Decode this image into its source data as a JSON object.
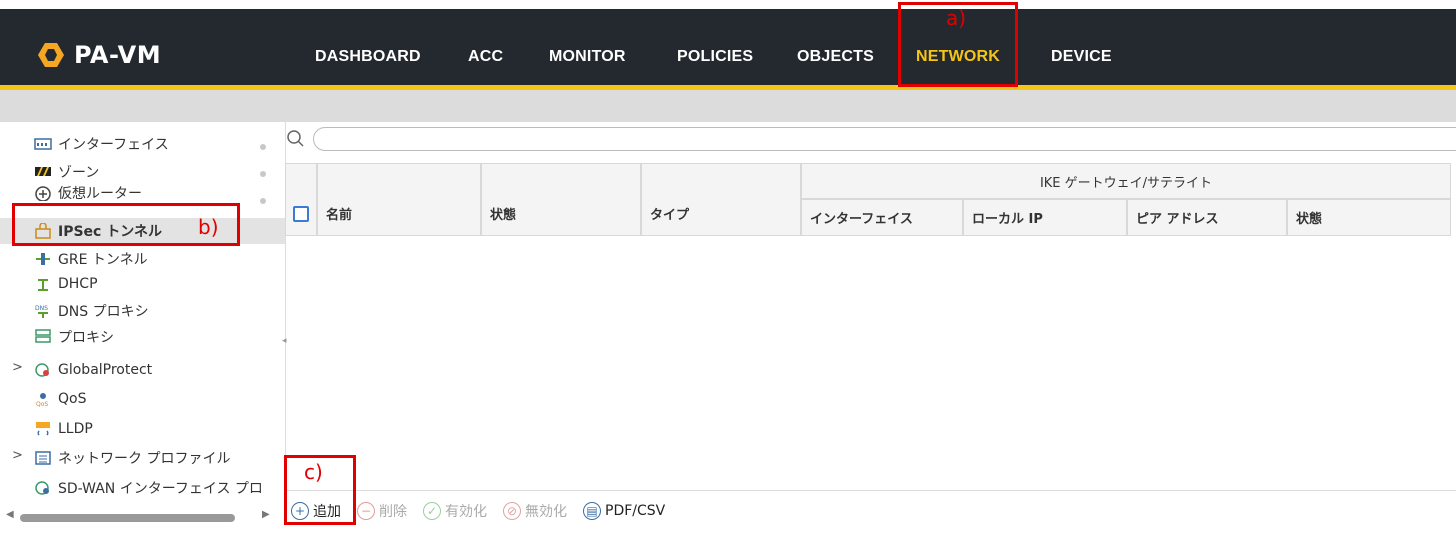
{
  "app": {
    "logo_text": "PA-VM"
  },
  "nav": {
    "tabs": [
      {
        "label": "DASHBOARD"
      },
      {
        "label": "ACC"
      },
      {
        "label": "MONITOR"
      },
      {
        "label": "POLICIES"
      },
      {
        "label": "OBJECTS"
      },
      {
        "label": "NETWORK",
        "active": true
      },
      {
        "label": "DEVICE"
      }
    ]
  },
  "sidebar": {
    "items": [
      {
        "label": "インターフェイス",
        "icon": "interface-icon"
      },
      {
        "label": "ゾーン",
        "icon": "zone-icon"
      },
      {
        "label": "仮想ルーター",
        "icon": "virtual-router-icon"
      },
      {
        "label": "IPSec トンネル",
        "icon": "ipsec-tunnel-icon",
        "active": true
      },
      {
        "label": "GRE トンネル",
        "icon": "gre-tunnel-icon"
      },
      {
        "label": "DHCP",
        "icon": "dhcp-icon"
      },
      {
        "label": "DNS プロキシ",
        "icon": "dns-proxy-icon"
      },
      {
        "label": "プロキシ",
        "icon": "proxy-icon"
      },
      {
        "label": "GlobalProtect",
        "icon": "globalprotect-icon"
      },
      {
        "label": "QoS",
        "icon": "qos-icon"
      },
      {
        "label": "LLDP",
        "icon": "lldp-icon"
      },
      {
        "label": "ネットワーク プロファイル",
        "icon": "network-profile-icon"
      },
      {
        "label": "SD-WAN インターフェイス プロ",
        "icon": "sdwan-icon"
      }
    ]
  },
  "table": {
    "group_header": "IKE ゲートウェイ/サテライト",
    "columns": [
      "名前",
      "状態",
      "タイプ",
      "インターフェイス",
      "ローカル IP",
      "ピア アドレス",
      "状態"
    ]
  },
  "actions": [
    {
      "label": "追加",
      "icon": "add-icon",
      "enabled": true
    },
    {
      "label": "削除",
      "icon": "delete-icon",
      "enabled": false
    },
    {
      "label": "有効化",
      "icon": "enable-icon",
      "enabled": false
    },
    {
      "label": "無効化",
      "icon": "disable-icon",
      "enabled": false
    },
    {
      "label": "PDF/CSV",
      "icon": "pdf-csv-icon",
      "enabled": true
    }
  ],
  "annotations": {
    "a": "a)",
    "b": "b)",
    "c": "c)"
  },
  "colors": {
    "nav_bg": "#24292f",
    "accent": "#f5c518",
    "annotation": "#e00000",
    "link_blue": "#3a7bd5"
  }
}
